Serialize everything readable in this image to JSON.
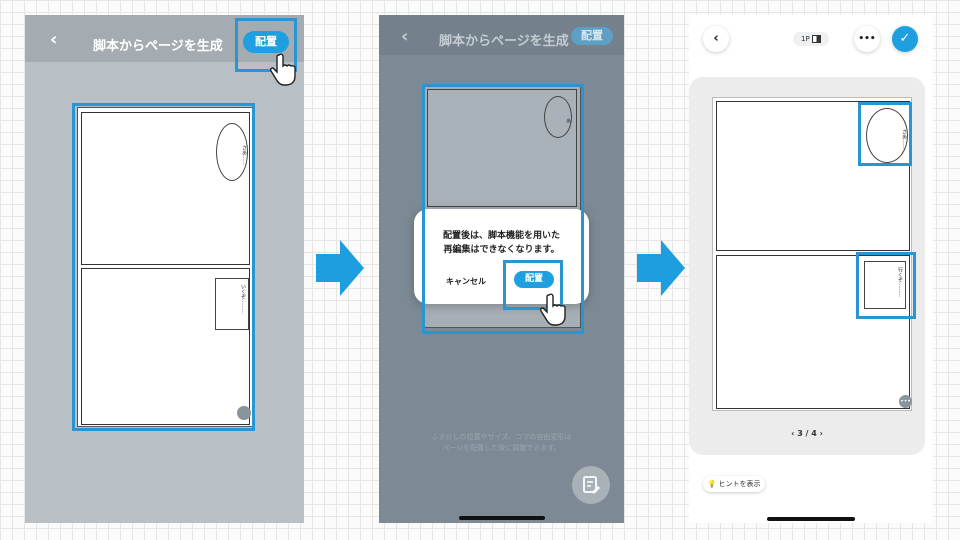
{
  "step1": {
    "header_title": "脚本からページを生成",
    "place_button": "配置",
    "bubble_top": "さあ……",
    "bubble_bottom": "いくぞ………"
  },
  "step2": {
    "header_title": "脚本からページを生成",
    "place_button": "配置",
    "bubble_top": "あ",
    "dialog_message_line1": "配置後は、脚本機能を用いた",
    "dialog_message_line2": "再編集はできなくなります。",
    "dialog_cancel": "キャンセル",
    "dialog_confirm": "配置",
    "hint_line1": "ふきだしの位置やサイズ、コマの自由変形は",
    "hint_line2": "ページを配置した後に調整できます。"
  },
  "step3": {
    "page_mode": "1P",
    "more": "•••",
    "bubble_top": "さあ……",
    "bubble_bottom": "行くぞ………",
    "pager": "3 / 4",
    "hint_button": "ヒントを表示"
  },
  "colors": {
    "accent": "#1ea0e0",
    "highlight": "#2a95d3",
    "arrow": "#1e9ede"
  }
}
